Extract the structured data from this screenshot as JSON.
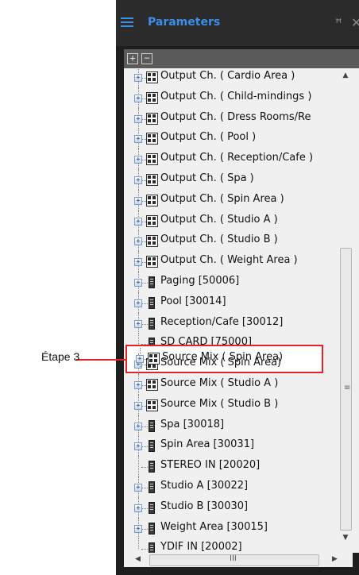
{
  "panel": {
    "title": "Parameters",
    "pin_icon": "pin-icon",
    "close_icon": "close-icon",
    "toolbar": {
      "expand_label": "+",
      "collapse_label": "−"
    }
  },
  "tree": {
    "items": [
      {
        "label": "Output Ch. ( Cardio Area )",
        "icon": "matrix-icon",
        "expandable": true
      },
      {
        "label": "Output Ch. ( Child-mindings )",
        "icon": "matrix-icon",
        "expandable": true
      },
      {
        "label": "Output Ch. ( Dress Rooms/Re",
        "icon": "matrix-icon",
        "expandable": true
      },
      {
        "label": "Output Ch. ( Pool )",
        "icon": "matrix-icon",
        "expandable": true
      },
      {
        "label": "Output Ch. ( Reception/Cafe )",
        "icon": "matrix-icon",
        "expandable": true
      },
      {
        "label": "Output Ch. ( Spa )",
        "icon": "matrix-icon",
        "expandable": true
      },
      {
        "label": "Output Ch. ( Spin Area )",
        "icon": "matrix-icon",
        "expandable": true
      },
      {
        "label": "Output Ch. ( Studio A )",
        "icon": "matrix-icon",
        "expandable": true
      },
      {
        "label": "Output Ch. ( Studio B )",
        "icon": "matrix-icon",
        "expandable": true
      },
      {
        "label": "Output Ch. ( Weight Area )",
        "icon": "matrix-icon",
        "expandable": true
      },
      {
        "label": "Paging [50006]",
        "icon": "device-icon",
        "expandable": true
      },
      {
        "label": "Pool [30014]",
        "icon": "device-icon",
        "expandable": true
      },
      {
        "label": "Reception/Cafe [30012]",
        "icon": "device-icon",
        "expandable": true
      },
      {
        "label": "SD CARD [75000]",
        "icon": "device-icon",
        "expandable": false
      },
      {
        "label": "Source Mix ( Spin Area)",
        "icon": "matrix-icon",
        "expandable": true
      },
      {
        "label": "Source Mix ( Studio A )",
        "icon": "matrix-icon",
        "expandable": true
      },
      {
        "label": "Source Mix ( Studio B )",
        "icon": "matrix-icon",
        "expandable": true
      },
      {
        "label": "Spa [30018]",
        "icon": "device-icon",
        "expandable": true
      },
      {
        "label": "Spin Area [30031]",
        "icon": "device-icon",
        "expandable": true
      },
      {
        "label": "STEREO IN [20020]",
        "icon": "device-icon",
        "expandable": false
      },
      {
        "label": "Studio A [30022]",
        "icon": "device-icon",
        "expandable": true
      },
      {
        "label": "Studio B [30030]",
        "icon": "device-icon",
        "expandable": true
      },
      {
        "label": "Weight Area [30015]",
        "icon": "device-icon",
        "expandable": true
      },
      {
        "label": "YDIF IN [20002]",
        "icon": "device-icon",
        "expandable": false
      }
    ]
  },
  "callout": {
    "label": "Étape 3",
    "highlighted_item": "Source Mix ( Spin Area)",
    "color": "#e8202a"
  },
  "colors": {
    "title_accent": "#3c8ee8",
    "panel_bg": "#1e1e1e",
    "tree_bg": "#f0f0f0"
  }
}
